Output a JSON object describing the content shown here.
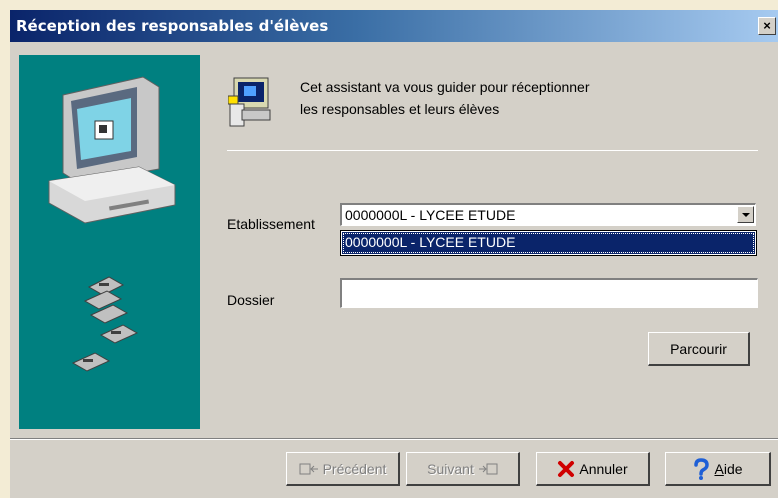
{
  "window": {
    "title": "Réception des responsables d'élèves",
    "close_glyph": "×"
  },
  "intro": {
    "line1": "Cet assistant va vous guider pour réceptionner",
    "line2": "les responsables et leurs élèves"
  },
  "form": {
    "etablissement_label": "Etablissement",
    "etablissement_value": "0000000L - LYCEE ETUDE",
    "dropdown_options": [
      "0000000L - LYCEE ETUDE"
    ],
    "dossier_label": "Dossier",
    "dossier_value": ""
  },
  "buttons": {
    "parcourir": "Parcourir",
    "precedent": "Précédent",
    "suivant": "Suivant",
    "annuler": "Annuler",
    "aide_accel": "A",
    "aide_rest": "ide"
  },
  "icons": {
    "panel": [
      "computer-icon",
      "floppy-disk-icon"
    ],
    "wizard": "wizard-computer-icon",
    "annuler": "red-x-icon",
    "aide": "blue-question-icon"
  },
  "colors": {
    "panel": "#008080",
    "titlebar_start": "#0a246a",
    "selection": "#0a246a"
  }
}
